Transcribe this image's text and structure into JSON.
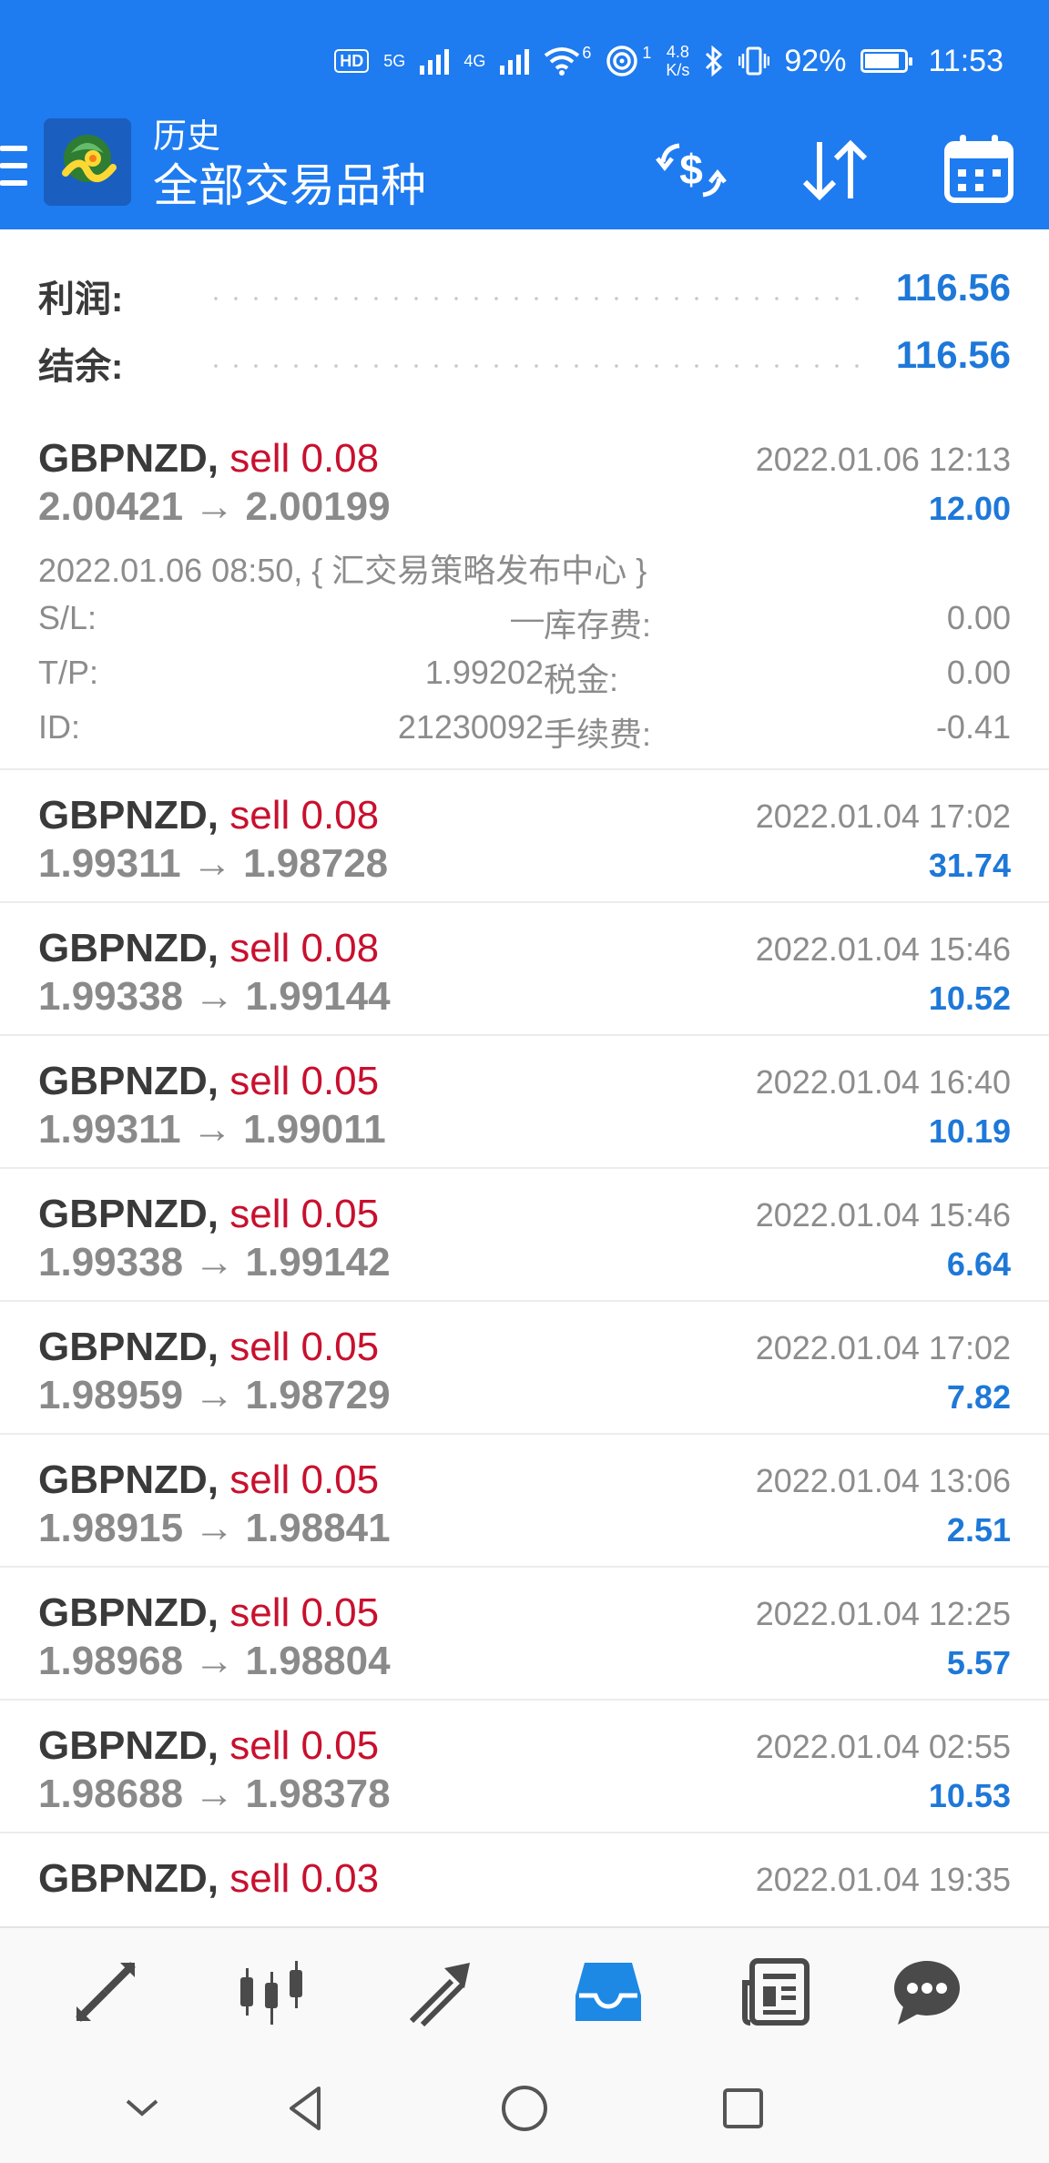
{
  "status_bar": {
    "hd": "HD",
    "sim1": "5G",
    "sim2": "4G",
    "wifi_sup": "6",
    "hotspot_sup": "1",
    "speed_value": "4.8",
    "speed_unit": "K/s",
    "battery_percent": "92%",
    "battery_level": 0.92,
    "time": "11:53"
  },
  "app_bar": {
    "title": "历史",
    "subtitle": "全部交易品种",
    "icons": [
      "menu-icon",
      "app-logo",
      "currency-exchange-icon",
      "sort-icon",
      "calendar-icon"
    ]
  },
  "summary": {
    "profit_label": "利润:",
    "profit_value": "116.56",
    "balance_label": "结余:",
    "balance_value": "116.56"
  },
  "trades": [
    {
      "symbol": "GBPNZD,",
      "side": "sell 0.08",
      "open_price": "2.00421",
      "arrow": "→",
      "close_price": "2.00199",
      "time": "2022.01.06 12:13",
      "profit": "12.00",
      "details": {
        "comment": "2022.01.06 08:50, { 汇交易策略发布中心 }",
        "sl_label": "S/L:",
        "sl_value": "—",
        "tp_label": "T/P:",
        "tp_value": "1.99202",
        "id_label": "ID:",
        "id_value": "21230092",
        "swap_label": "库存费:",
        "swap_value": "0.00",
        "tax_label": "税金:",
        "tax_value": "0.00",
        "commission_label": "手续费:",
        "commission_value": "-0.41"
      }
    },
    {
      "symbol": "GBPNZD,",
      "side": "sell 0.08",
      "open_price": "1.99311",
      "arrow": "→",
      "close_price": "1.98728",
      "time": "2022.01.04 17:02",
      "profit": "31.74"
    },
    {
      "symbol": "GBPNZD,",
      "side": "sell 0.08",
      "open_price": "1.99338",
      "arrow": "→",
      "close_price": "1.99144",
      "time": "2022.01.04 15:46",
      "profit": "10.52"
    },
    {
      "symbol": "GBPNZD,",
      "side": "sell 0.05",
      "open_price": "1.99311",
      "arrow": "→",
      "close_price": "1.99011",
      "time": "2022.01.04 16:40",
      "profit": "10.19"
    },
    {
      "symbol": "GBPNZD,",
      "side": "sell 0.05",
      "open_price": "1.99338",
      "arrow": "→",
      "close_price": "1.99142",
      "time": "2022.01.04 15:46",
      "profit": "6.64"
    },
    {
      "symbol": "GBPNZD,",
      "side": "sell 0.05",
      "open_price": "1.98959",
      "arrow": "→",
      "close_price": "1.98729",
      "time": "2022.01.04 17:02",
      "profit": "7.82"
    },
    {
      "symbol": "GBPNZD,",
      "side": "sell 0.05",
      "open_price": "1.98915",
      "arrow": "→",
      "close_price": "1.98841",
      "time": "2022.01.04 13:06",
      "profit": "2.51"
    },
    {
      "symbol": "GBPNZD,",
      "side": "sell 0.05",
      "open_price": "1.98968",
      "arrow": "→",
      "close_price": "1.98804",
      "time": "2022.01.04 12:25",
      "profit": "5.57"
    },
    {
      "symbol": "GBPNZD,",
      "side": "sell 0.05",
      "open_price": "1.98688",
      "arrow": "→",
      "close_price": "1.98378",
      "time": "2022.01.04 02:55",
      "profit": "10.53"
    },
    {
      "symbol": "GBPNZD,",
      "side": "sell 0.03",
      "open_price": "",
      "arrow": "",
      "close_price": "",
      "time": "2022.01.04 19:35",
      "profit": ""
    }
  ],
  "bottom_nav": {
    "items": [
      "quotes-icon",
      "chart-candles-icon",
      "trade-icon",
      "history-icon",
      "news-icon",
      "chat-icon"
    ],
    "active": "history-icon",
    "active_color": "#1e88e5"
  },
  "colors": {
    "app_bar": "#1f7bf0",
    "sell": "#c8102e",
    "profit": "#1e78d8"
  }
}
